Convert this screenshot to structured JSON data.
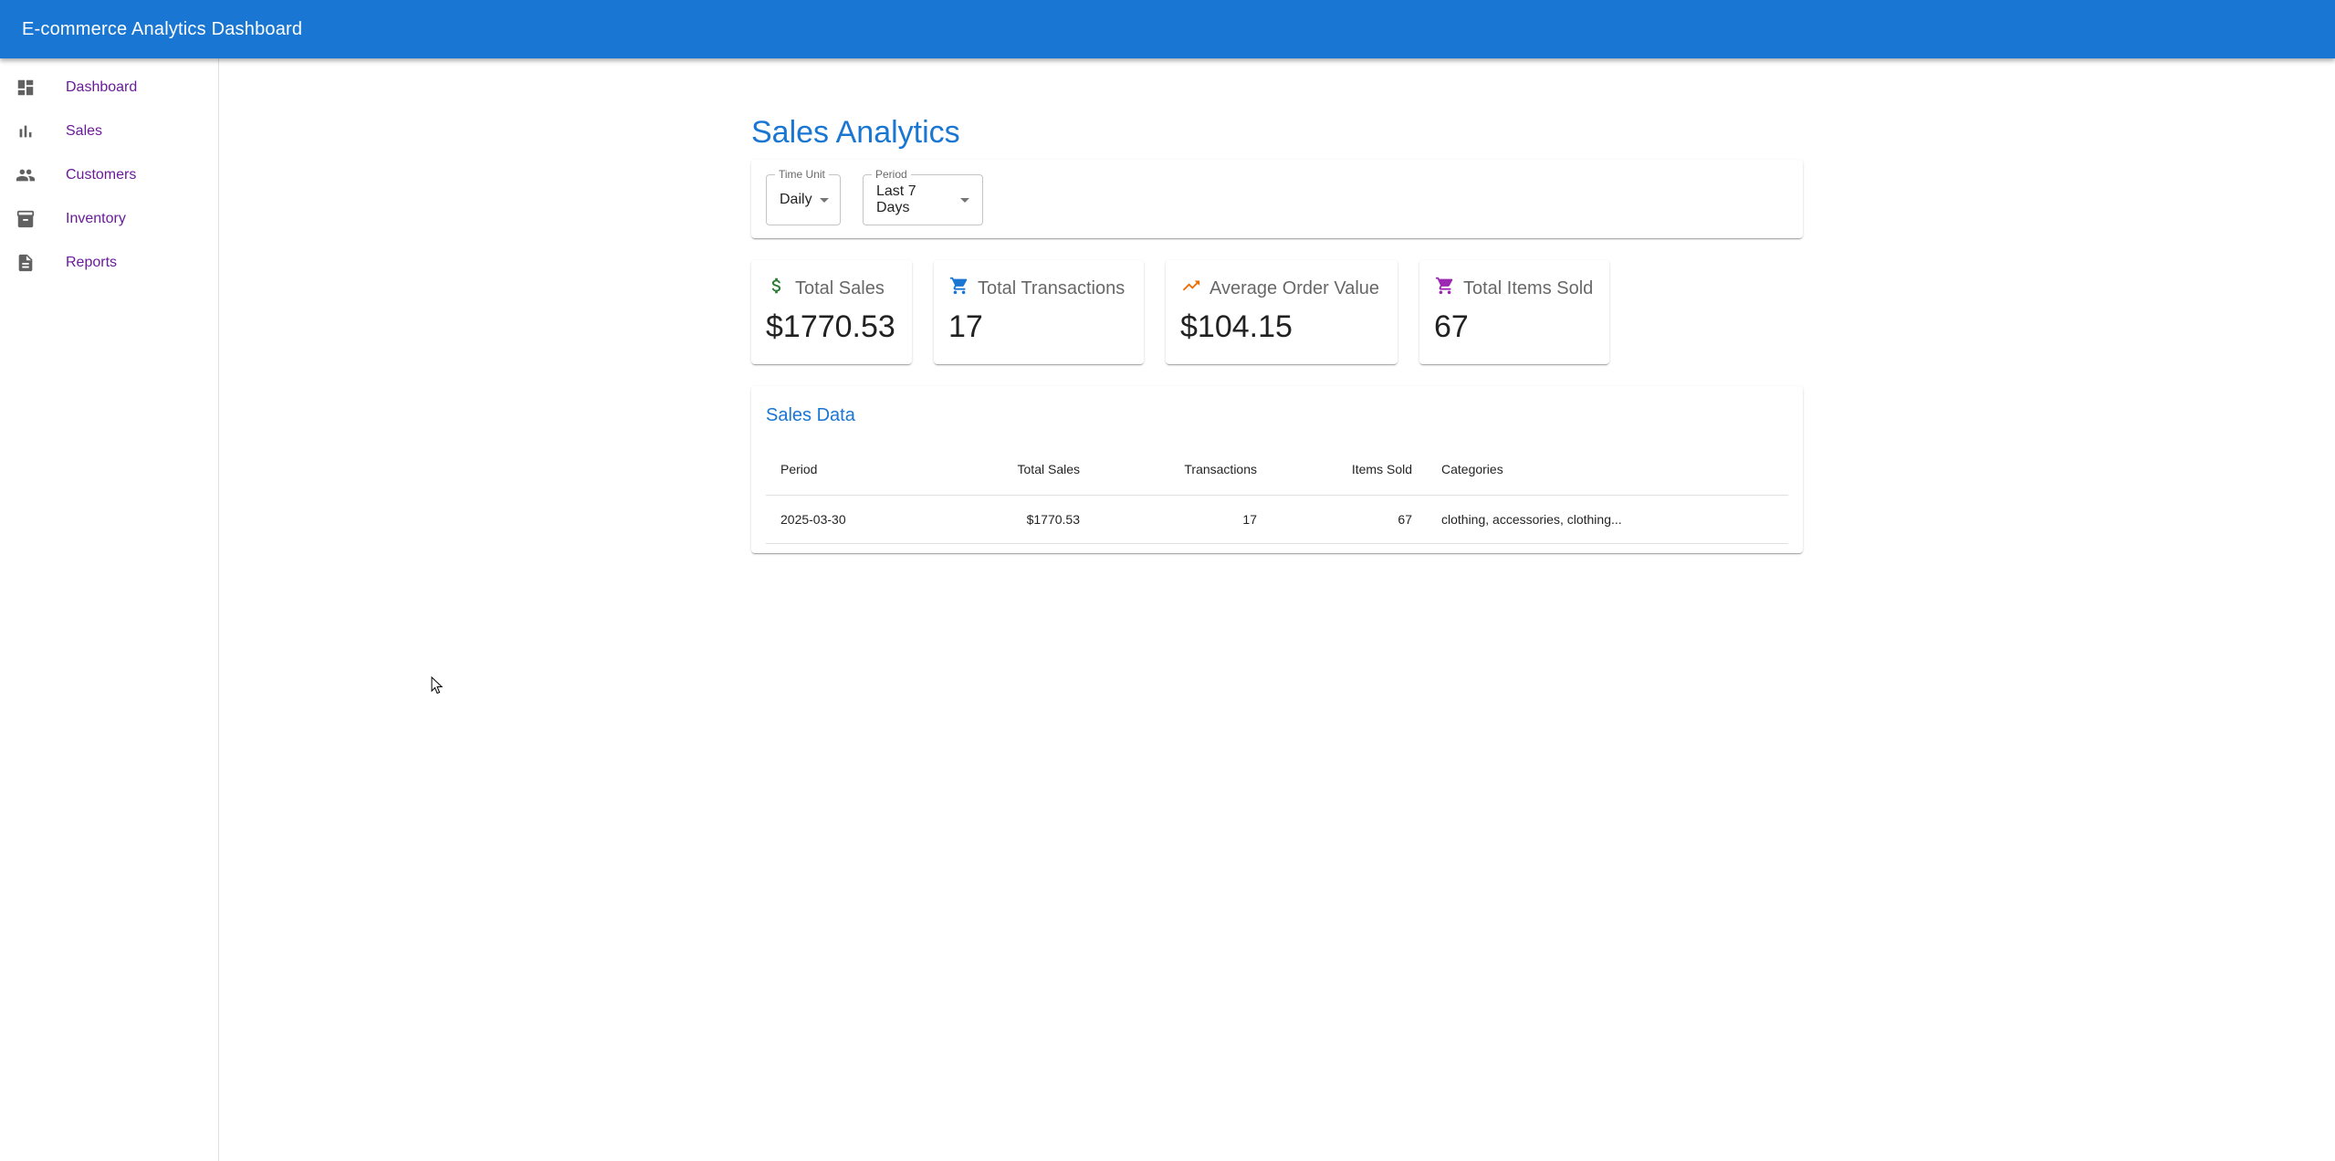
{
  "appbar": {
    "title": "E-commerce Analytics Dashboard",
    "color": "#1976d2"
  },
  "sidebar": {
    "items": [
      {
        "label": "Dashboard",
        "icon": "dashboard-icon"
      },
      {
        "label": "Sales",
        "icon": "bar-chart-icon"
      },
      {
        "label": "Customers",
        "icon": "people-icon"
      },
      {
        "label": "Inventory",
        "icon": "inventory-box-icon"
      },
      {
        "label": "Reports",
        "icon": "document-icon"
      }
    ]
  },
  "page": {
    "title": "Sales Analytics"
  },
  "filters": {
    "time_unit": {
      "label": "Time Unit",
      "value": "Daily"
    },
    "period": {
      "label": "Period",
      "value": "Last 7 Days"
    }
  },
  "cards": [
    {
      "title": "Total Sales",
      "value": "$1770.53",
      "icon": "dollar-icon",
      "icon_color": "#2e7d32"
    },
    {
      "title": "Total Transactions",
      "value": "17",
      "icon": "cart-icon",
      "icon_color": "#1976d2"
    },
    {
      "title": "Average Order Value",
      "value": "$104.15",
      "icon": "trending-up-icon",
      "icon_color": "#ed6c02"
    },
    {
      "title": "Total Items Sold",
      "value": "67",
      "icon": "cart-icon",
      "icon_color": "#9c27b0"
    }
  ],
  "sales_table": {
    "title": "Sales Data",
    "columns": [
      "Period",
      "Total Sales",
      "Transactions",
      "Items Sold",
      "Categories"
    ],
    "rows": [
      {
        "period": "2025-03-30",
        "total_sales": "$1770.53",
        "transactions": "17",
        "items_sold": "67",
        "categories": "clothing, accessories, clothing..."
      }
    ]
  }
}
